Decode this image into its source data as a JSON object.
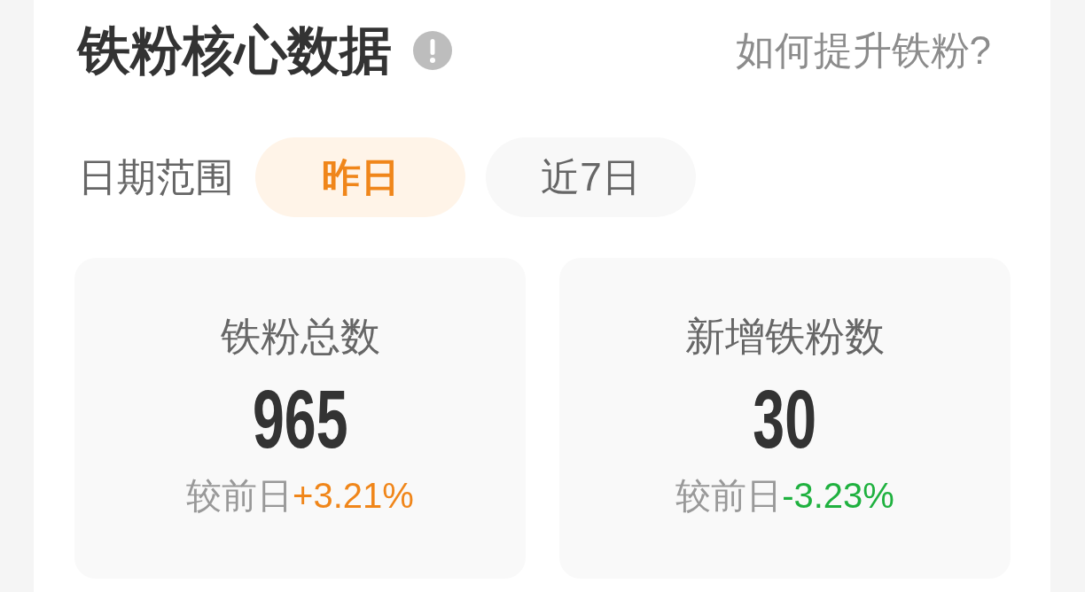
{
  "header": {
    "title": "铁粉核心数据",
    "help_link": "如何提升铁粉?"
  },
  "date_range": {
    "label": "日期范围",
    "options": [
      {
        "label": "昨日",
        "selected": true
      },
      {
        "label": "近7日",
        "selected": false
      }
    ]
  },
  "cards": [
    {
      "label": "铁粉总数",
      "value": "965",
      "comparison": "较前日",
      "change": "+3.21%",
      "color": "#f0861a"
    },
    {
      "label": "新增铁粉数",
      "value": "30",
      "comparison": "较前日",
      "change": "-3.23%",
      "color": "#1fb13f"
    }
  ]
}
